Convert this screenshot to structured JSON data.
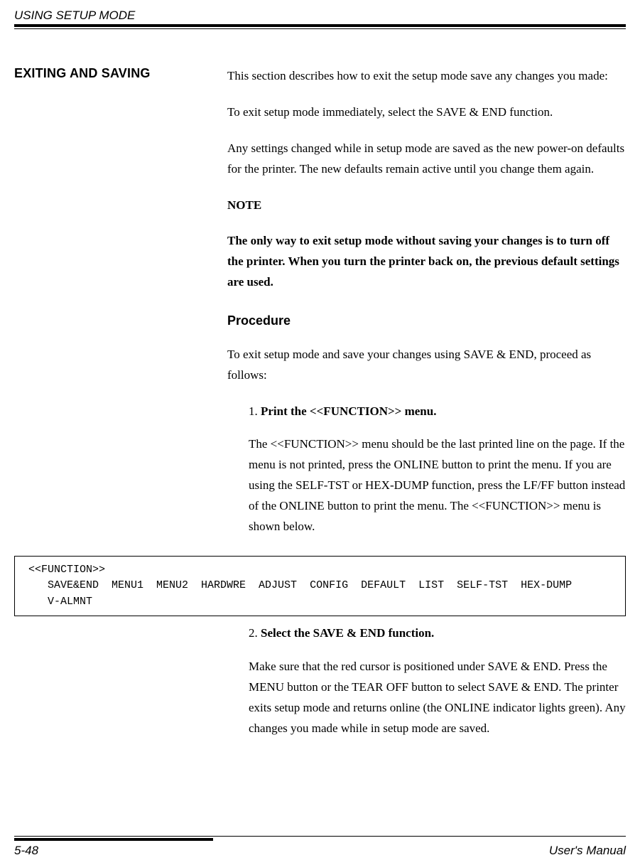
{
  "running_head": "USING SETUP MODE",
  "section_head": "EXITING AND SAVING",
  "body": {
    "intro1": "This section describes how to exit the setup mode save any changes you made:",
    "intro2": "To exit setup mode immediately, select the SAVE & END function.",
    "intro3": "Any settings changed while in setup mode are saved as the new power-on defaults for the printer.  The new defaults remain active until you change them again.",
    "note_label": "NOTE",
    "note_body": "The only way to exit setup mode without saving your changes is to turn off the printer.  When you turn the printer back on, the previous default settings are used."
  },
  "procedure": {
    "heading": "Procedure",
    "lead": "To exit setup mode and save your changes using SAVE & END, proceed as follows:",
    "steps": {
      "s1": {
        "num": "1.",
        "title": "Print the <<FUNCTION>> menu.",
        "para": "The <<FUNCTION>> menu should be the last printed line on the page.  If the menu is not printed, press the ONLINE button to print the menu.  If you are using the SELF-TST or HEX-DUMP function, press the LF/FF button instead of the ONLINE button to print the menu.  The <<FUNCTION>> menu is shown below."
      },
      "s2": {
        "num": "2.",
        "title": "Select the SAVE & END function.",
        "para": "Make sure that the red cursor is positioned under SAVE & END.  Press the MENU button or the TEAR OFF button to select SAVE & END.  The printer exits setup mode and returns online (the ONLINE indicator lights green).  Any changes you made while in setup mode are saved."
      }
    }
  },
  "code_box": " <<FUNCTION>>\n    SAVE&END  MENU1  MENU2  HARDWRE  ADJUST  CONFIG  DEFAULT  LIST  SELF-TST  HEX-DUMP\n    V-ALMNT",
  "footer": {
    "page_num": "5-48",
    "manual": "User's Manual"
  }
}
